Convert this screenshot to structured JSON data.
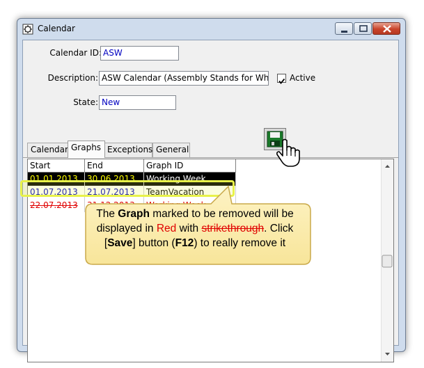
{
  "window": {
    "title": "Calendar",
    "controls": {
      "minimize": "minimize",
      "maximize": "maximize",
      "close": "close"
    }
  },
  "form": {
    "calendar_id_label": "Calendar ID:",
    "calendar_id_value": "ASW",
    "description_label": "Description:",
    "description_value": "ASW Calendar (Assembly Stands for Wheels)",
    "active_label": "Active",
    "active_checked": true,
    "state_label": "State:",
    "state_value": "New"
  },
  "tabs": [
    {
      "label": "Calendar",
      "active": false
    },
    {
      "label": "Graphs",
      "active": true
    },
    {
      "label": "Exceptions",
      "active": false
    },
    {
      "label": "General",
      "active": false
    }
  ],
  "grid": {
    "columns": [
      "Start",
      "End",
      "Graph ID"
    ],
    "rows": [
      {
        "start": "01.01.2013",
        "end": "30.06.2013",
        "graph_id": "Working Week",
        "state": "selected"
      },
      {
        "start": "01.07.2013",
        "end": "21.07.2013",
        "graph_id": "TeamVacation",
        "state": "normal"
      },
      {
        "start": "22.07.2013",
        "end": "31.12.2013",
        "graph_id": "Working Week",
        "state": "removed"
      }
    ]
  },
  "callout": {
    "t1": "The ",
    "t2": "Graph",
    "t3": " marked to be removed will be displayed in ",
    "t4": "Red",
    "t5": " with ",
    "t6": "strikethrough",
    "t7": ".  Click [",
    "t8": "Save",
    "t9": "] button (",
    "t10": "F12",
    "t11": ") to really remove it"
  },
  "colors": {
    "selected_row_bg": "#000000",
    "selected_row_text": "#ffff00",
    "normal_row_text": "#0000c0",
    "removed_row_text": "#e00000",
    "highlight": "#e8f24a",
    "callout_fill": "#fbeeb0",
    "callout_border": "#c9a94a"
  },
  "icons": [
    "calendar-app-icon",
    "save-icon",
    "hand-cursor-icon"
  ]
}
